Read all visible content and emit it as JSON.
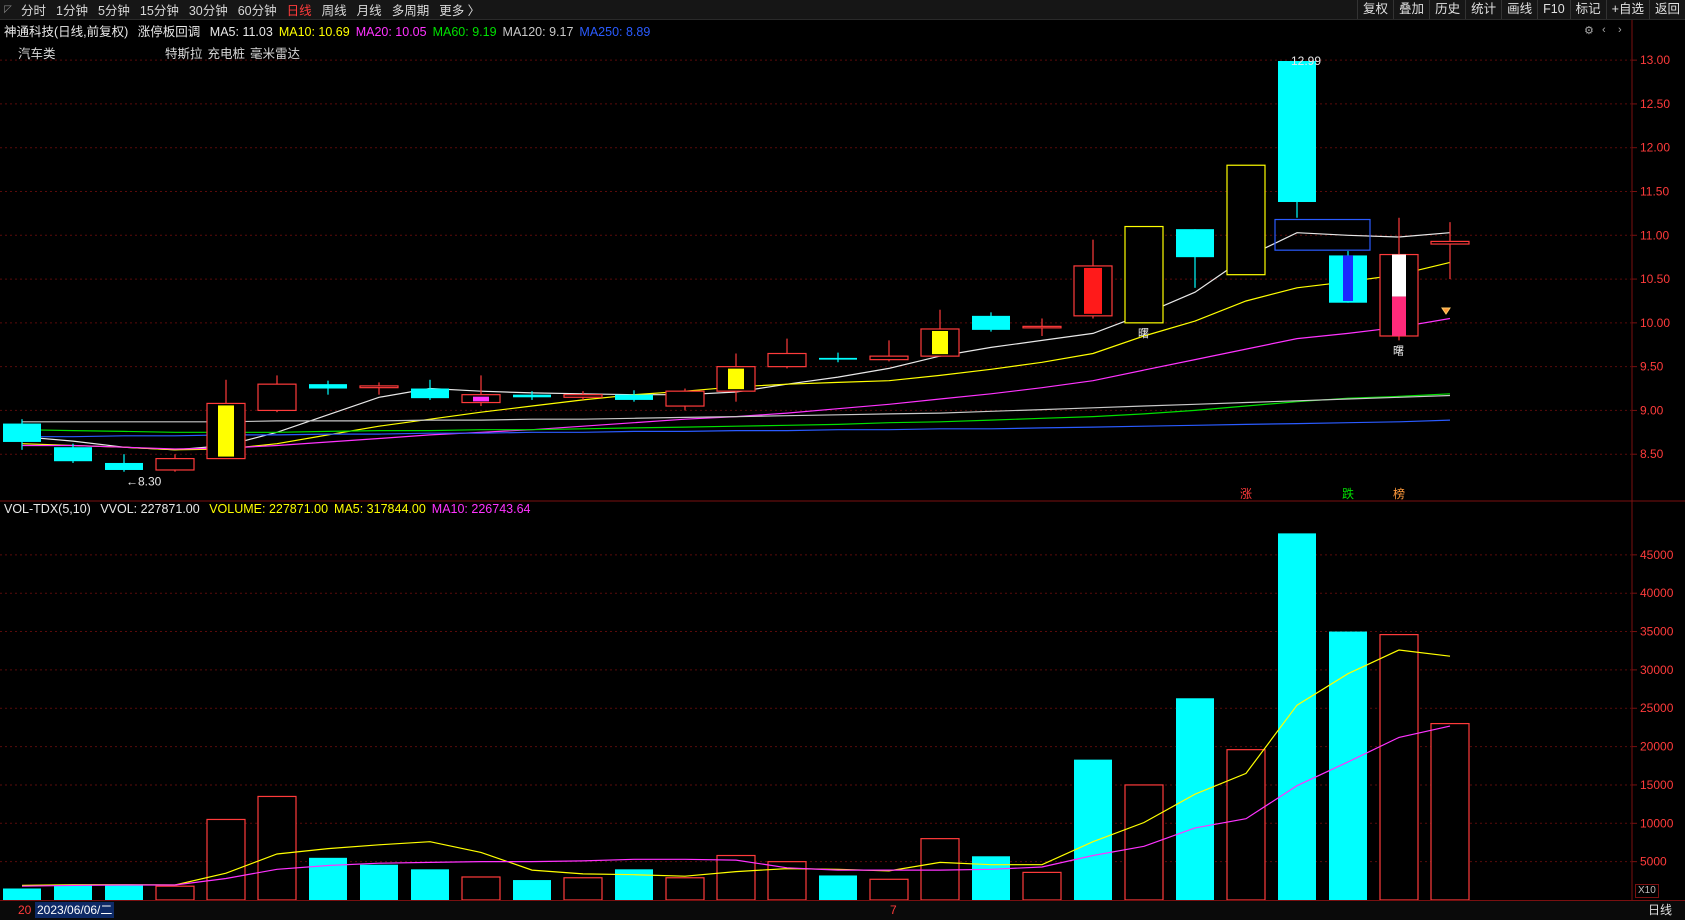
{
  "toolbar": {
    "tabs": [
      {
        "label": "分时",
        "active": false
      },
      {
        "label": "1分钟",
        "active": false
      },
      {
        "label": "5分钟",
        "active": false
      },
      {
        "label": "15分钟",
        "active": false
      },
      {
        "label": "30分钟",
        "active": false
      },
      {
        "label": "60分钟",
        "active": false
      },
      {
        "label": "日线",
        "active": true
      },
      {
        "label": "周线",
        "active": false
      },
      {
        "label": "月线",
        "active": false
      },
      {
        "label": "多周期",
        "active": false
      },
      {
        "label": "更多 〉",
        "active": false
      }
    ],
    "actions": [
      "复权",
      "叠加",
      "历史",
      "统计",
      "画线",
      "F10",
      "标记",
      "+自选",
      "返回"
    ]
  },
  "price_legend": {
    "title": "神通科技(日线,前复权)",
    "indicator": "涨停板回调",
    "ma": [
      {
        "label": "MA5: 11.03",
        "color": "#e8e8e8"
      },
      {
        "label": "MA10: 10.69",
        "color": "#ffff00"
      },
      {
        "label": "MA20: 10.05",
        "color": "#ff33ff"
      },
      {
        "label": "MA60: 9.19",
        "color": "#00e000"
      },
      {
        "label": "MA120: 9.17",
        "color": "#c8c8c8"
      },
      {
        "label": "MA250: 8.89",
        "color": "#2a5bff"
      }
    ]
  },
  "sector": "汽车类",
  "concepts": [
    "特斯拉",
    "充电桩",
    "毫米雷达"
  ],
  "volume_legend": {
    "name": "VOL-TDX(5,10)",
    "vvol": "VVOL: 227871.00",
    "items": [
      {
        "label": "VOLUME: 227871.00",
        "color": "#ffff00"
      },
      {
        "label": "MA5: 317844.00",
        "color": "#ffff00"
      },
      {
        "label": "MA10: 226743.64",
        "color": "#ff33ff"
      }
    ]
  },
  "footer": {
    "date": "2023/06/06/二",
    "left_label": "20",
    "mid_label": "7",
    "period": "日线",
    "scale_badge": "X10"
  },
  "chart_data": [
    {
      "type": "candlestick",
      "ylim": [
        8.0,
        13.15
      ],
      "y_ticks": [
        "13.00",
        "12.50",
        "12.00",
        "11.50",
        "11.00",
        "10.50",
        "10.00",
        "9.50",
        "9.00",
        "8.50"
      ],
      "annotations": {
        "high": "12.99",
        "low": "←8.30"
      },
      "signal_labels": [
        {
          "text": "涨",
          "index": 24,
          "color": "#ff3b3b"
        },
        {
          "text": "跌",
          "index": 26,
          "color": "#00e000"
        },
        {
          "text": "榜",
          "index": 27,
          "color": "#ff9a3b"
        }
      ],
      "marks": [
        {
          "text": "曙",
          "index": 22
        },
        {
          "text": "曙",
          "index": 27
        }
      ],
      "candles": [
        {
          "o": 8.64,
          "h": 8.9,
          "l": 8.55,
          "c": 8.85,
          "color": "cyan"
        },
        {
          "o": 8.58,
          "h": 8.62,
          "l": 8.4,
          "c": 8.42,
          "color": "cyan"
        },
        {
          "o": 8.4,
          "h": 8.5,
          "l": 8.3,
          "c": 8.32,
          "color": "cyan"
        },
        {
          "o": 8.32,
          "h": 8.5,
          "l": 8.3,
          "c": 8.45,
          "color": "red"
        },
        {
          "o": 8.45,
          "h": 9.35,
          "l": 8.45,
          "c": 9.08,
          "color": "red",
          "body_fill": "yellow"
        },
        {
          "o": 9.0,
          "h": 9.4,
          "l": 8.98,
          "c": 9.3,
          "color": "red"
        },
        {
          "o": 9.3,
          "h": 9.34,
          "l": 9.18,
          "c": 9.25,
          "color": "cyan"
        },
        {
          "o": 9.28,
          "h": 9.32,
          "l": 9.18,
          "c": 9.26,
          "color": "red"
        },
        {
          "o": 9.25,
          "h": 9.35,
          "l": 9.12,
          "c": 9.14,
          "color": "cyan"
        },
        {
          "o": 9.09,
          "h": 9.4,
          "l": 9.05,
          "c": 9.18,
          "color": "red",
          "body_fill": "magenta"
        },
        {
          "o": 9.18,
          "h": 9.22,
          "l": 9.12,
          "c": 9.15,
          "color": "cyan"
        },
        {
          "o": 9.15,
          "h": 9.22,
          "l": 9.12,
          "c": 9.18,
          "color": "red"
        },
        {
          "o": 9.18,
          "h": 9.23,
          "l": 9.1,
          "c": 9.12,
          "color": "cyan"
        },
        {
          "o": 9.05,
          "h": 9.25,
          "l": 9.0,
          "c": 9.22,
          "color": "red"
        },
        {
          "o": 9.22,
          "h": 9.65,
          "l": 9.1,
          "c": 9.5,
          "color": "red",
          "body_fill": "yellow"
        },
        {
          "o": 9.5,
          "h": 9.82,
          "l": 9.48,
          "c": 9.65,
          "color": "red"
        },
        {
          "o": 9.6,
          "h": 9.66,
          "l": 9.55,
          "c": 9.58,
          "color": "cyan"
        },
        {
          "o": 9.58,
          "h": 9.8,
          "l": 9.56,
          "c": 9.62,
          "color": "red"
        },
        {
          "o": 9.62,
          "h": 10.15,
          "l": 9.62,
          "c": 9.93,
          "color": "red",
          "body_fill": "yellow"
        },
        {
          "o": 10.08,
          "h": 10.12,
          "l": 9.9,
          "c": 9.92,
          "color": "cyan"
        },
        {
          "o": 9.95,
          "h": 10.05,
          "l": 9.85,
          "c": 9.96,
          "color": "red"
        },
        {
          "o": 10.08,
          "h": 10.95,
          "l": 10.05,
          "c": 10.65,
          "color": "red",
          "body_fill": "red"
        },
        {
          "o": 10.0,
          "h": 11.1,
          "l": 10.0,
          "c": 11.1,
          "color": "yellow"
        },
        {
          "o": 11.07,
          "h": 11.07,
          "l": 10.4,
          "c": 10.75,
          "color": "cyan"
        },
        {
          "o": 10.55,
          "h": 11.8,
          "l": 10.55,
          "c": 11.8,
          "color": "yellow"
        },
        {
          "o": 12.99,
          "h": 12.99,
          "l": 11.2,
          "c": 11.38,
          "color": "cyan"
        },
        {
          "o": 10.77,
          "h": 10.82,
          "l": 10.23,
          "c": 10.23,
          "color": "cyan",
          "band": "blue",
          "band_top": 10.77,
          "band_bottom": 10.25
        },
        {
          "o": 9.85,
          "h": 11.2,
          "l": 9.8,
          "c": 10.78,
          "color": "red",
          "band": "white",
          "band_top": 10.78,
          "band_bottom": 10.3,
          "band_fill2": "#ff2a7a"
        },
        {
          "o": 10.9,
          "h": 11.15,
          "l": 10.5,
          "c": 10.93,
          "color": "red"
        }
      ],
      "blue_box": {
        "start_index": 25,
        "end_index": 26,
        "top": 11.18,
        "bottom": 10.83
      },
      "series": [
        {
          "name": "MA5",
          "color": "#e8e8e8",
          "values": [
            8.7,
            8.65,
            8.58,
            8.55,
            8.6,
            8.75,
            8.95,
            9.15,
            9.25,
            9.22,
            9.2,
            9.19,
            9.18,
            9.18,
            9.21,
            9.3,
            9.38,
            9.48,
            9.62,
            9.72,
            9.8,
            9.88,
            10.1,
            10.35,
            10.75,
            11.03,
            11.0,
            10.98,
            11.03
          ]
        },
        {
          "name": "MA10",
          "color": "#ffff00",
          "values": [
            8.62,
            8.6,
            8.58,
            8.55,
            8.56,
            8.62,
            8.72,
            8.82,
            8.9,
            8.98,
            9.05,
            9.12,
            9.18,
            9.22,
            9.27,
            9.3,
            9.32,
            9.34,
            9.4,
            9.47,
            9.55,
            9.65,
            9.85,
            10.02,
            10.25,
            10.4,
            10.47,
            10.55,
            10.69
          ]
        },
        {
          "name": "MA20",
          "color": "#ff33ff",
          "values": [
            8.6,
            8.6,
            8.58,
            8.56,
            8.57,
            8.6,
            8.64,
            8.68,
            8.72,
            8.75,
            8.78,
            8.82,
            8.86,
            8.9,
            8.93,
            8.97,
            9.02,
            9.07,
            9.13,
            9.19,
            9.26,
            9.34,
            9.46,
            9.58,
            9.7,
            9.82,
            9.88,
            9.95,
            10.05
          ]
        },
        {
          "name": "MA60",
          "color": "#00e000",
          "values": [
            8.78,
            8.77,
            8.76,
            8.75,
            8.75,
            8.75,
            8.76,
            8.77,
            8.77,
            8.78,
            8.78,
            8.79,
            8.8,
            8.81,
            8.82,
            8.83,
            8.84,
            8.86,
            8.87,
            8.89,
            8.91,
            8.93,
            8.96,
            9.0,
            9.05,
            9.1,
            9.14,
            9.16,
            9.19
          ]
        },
        {
          "name": "MA120",
          "color": "#c8c8c8",
          "values": [
            8.87,
            8.87,
            8.87,
            8.87,
            8.87,
            8.88,
            8.88,
            8.88,
            8.89,
            8.89,
            8.9,
            8.9,
            8.91,
            8.92,
            8.93,
            8.94,
            8.95,
            8.96,
            8.97,
            8.99,
            9.01,
            9.03,
            9.05,
            9.07,
            9.09,
            9.11,
            9.13,
            9.15,
            9.17
          ]
        },
        {
          "name": "MA250",
          "color": "#2a5bff",
          "values": [
            8.7,
            8.7,
            8.71,
            8.71,
            8.72,
            8.72,
            8.73,
            8.73,
            8.74,
            8.74,
            8.75,
            8.75,
            8.76,
            8.76,
            8.77,
            8.77,
            8.78,
            8.78,
            8.79,
            8.79,
            8.8,
            8.81,
            8.82,
            8.83,
            8.84,
            8.85,
            8.86,
            8.87,
            8.89
          ]
        }
      ]
    },
    {
      "type": "bar",
      "ylim": [
        0,
        48500
      ],
      "y_ticks": [
        "45000",
        "40000",
        "35000",
        "30000",
        "25000",
        "20000",
        "15000",
        "10000",
        "5000"
      ],
      "bars": [
        {
          "v": 1500,
          "color": "cyan"
        },
        {
          "v": 2000,
          "color": "cyan"
        },
        {
          "v": 2000,
          "color": "cyan"
        },
        {
          "v": 1800,
          "color": "red"
        },
        {
          "v": 10500,
          "color": "red"
        },
        {
          "v": 13500,
          "color": "red"
        },
        {
          "v": 5500,
          "color": "cyan"
        },
        {
          "v": 4600,
          "color": "cyan"
        },
        {
          "v": 4000,
          "color": "cyan"
        },
        {
          "v": 3000,
          "color": "red"
        },
        {
          "v": 2600,
          "color": "cyan"
        },
        {
          "v": 2900,
          "color": "red"
        },
        {
          "v": 4000,
          "color": "cyan"
        },
        {
          "v": 2900,
          "color": "red"
        },
        {
          "v": 5800,
          "color": "red"
        },
        {
          "v": 5000,
          "color": "red"
        },
        {
          "v": 3200,
          "color": "cyan"
        },
        {
          "v": 2700,
          "color": "red"
        },
        {
          "v": 8000,
          "color": "red"
        },
        {
          "v": 5700,
          "color": "cyan"
        },
        {
          "v": 3600,
          "color": "red"
        },
        {
          "v": 18300,
          "color": "cyan"
        },
        {
          "v": 15000,
          "color": "red"
        },
        {
          "v": 26300,
          "color": "cyan"
        },
        {
          "v": 19600,
          "color": "red"
        },
        {
          "v": 47800,
          "color": "cyan"
        },
        {
          "v": 35000,
          "color": "cyan"
        },
        {
          "v": 34600,
          "color": "red"
        },
        {
          "v": 23000,
          "color": "red"
        }
      ],
      "series": [
        {
          "name": "MA5",
          "color": "#ffff00",
          "values": [
            1900,
            2000,
            2000,
            1950,
            3500,
            6000,
            6700,
            7200,
            7600,
            6200,
            3900,
            3400,
            3300,
            3100,
            3700,
            4100,
            4000,
            3800,
            4900,
            4600,
            4600,
            7600,
            10100,
            13800,
            16500,
            25400,
            29500,
            32600,
            31784
          ]
        },
        {
          "name": "MA10",
          "color": "#ff33ff",
          "values": [
            1800,
            1900,
            1950,
            1950,
            2800,
            4000,
            4500,
            4800,
            4900,
            5000,
            5000,
            5100,
            5300,
            5300,
            5200,
            4200,
            3900,
            3900,
            3900,
            4000,
            4300,
            5800,
            7000,
            9400,
            10600,
            14900,
            18000,
            21200,
            22674
          ]
        }
      ]
    }
  ]
}
